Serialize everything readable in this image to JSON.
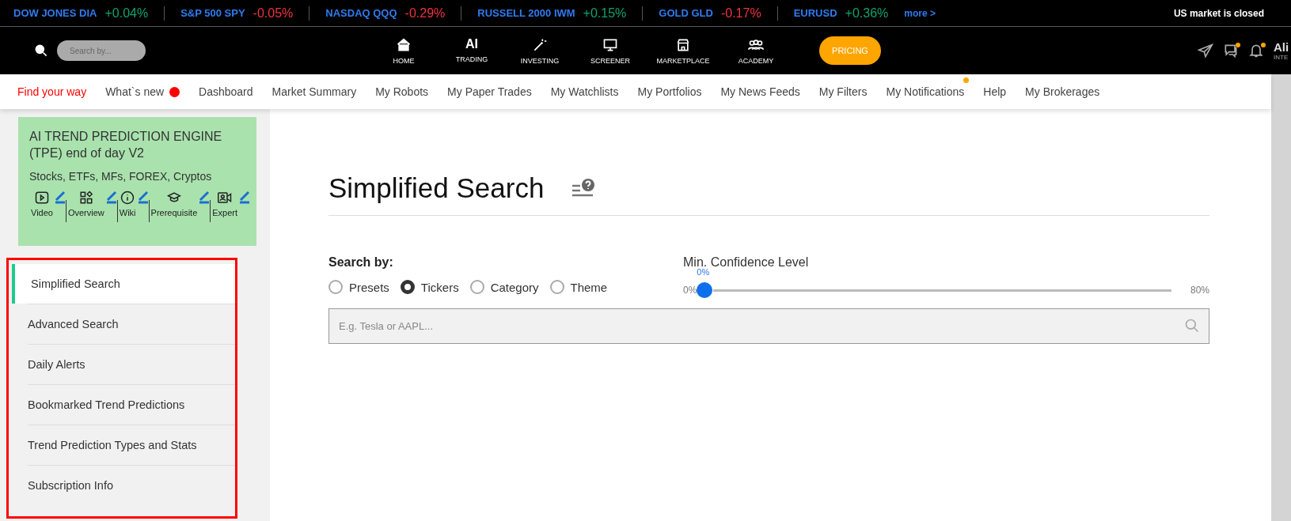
{
  "ticker": {
    "items": [
      {
        "name": "DOW JONES DIA",
        "change": "+0.04%",
        "color": "#10a36b"
      },
      {
        "name": "S&P 500 SPY",
        "change": "-0.05%",
        "color": "#f0323f"
      },
      {
        "name": "NASDAQ QQQ",
        "change": "-0.29%",
        "color": "#f0323f"
      },
      {
        "name": "RUSSELL 2000 IWM",
        "change": "+0.15%",
        "color": "#10a36b"
      },
      {
        "name": "GOLD GLD",
        "change": "-0.17%",
        "color": "#f0323f"
      },
      {
        "name": "EURUSD",
        "change": "+0.36%",
        "color": "#10a36b"
      }
    ],
    "more": "more >",
    "status": "US market is closed"
  },
  "header": {
    "search": {
      "placeholder": "Search by..."
    },
    "nav": [
      {
        "label": "HOME"
      },
      {
        "label": "TRADING",
        "mark": "AI"
      },
      {
        "label": "INVESTING"
      },
      {
        "label": "SCREENER"
      },
      {
        "label": "MARKETPLACE"
      },
      {
        "label": "ACADEMY"
      }
    ],
    "pricing": "PRICING",
    "alerts": [
      {
        "dot": false
      },
      {
        "dot": true
      },
      {
        "dot": true
      }
    ],
    "user": {
      "name": "Ali",
      "sub": "INTE"
    }
  },
  "subnav": [
    {
      "label": "Find your way",
      "selected": true
    },
    {
      "label": "What`s new",
      "selected": false,
      "color": "#ff0000"
    },
    {
      "label": "Dashboard",
      "selected": false
    },
    {
      "label": "Market Summary",
      "selected": false
    },
    {
      "label": "My Robots",
      "selected": false
    },
    {
      "label": "My Paper Trades",
      "selected": false
    },
    {
      "label": "My Watchlists",
      "selected": false
    },
    {
      "label": "My Portfolios",
      "selected": false
    },
    {
      "label": "My News Feeds",
      "selected": false
    },
    {
      "label": "My Filters",
      "selected": false
    },
    {
      "label": "My Notifications",
      "selected": false,
      "color": "#ffa500"
    },
    {
      "label": "Help",
      "selected": false
    },
    {
      "label": "My Brokerages",
      "selected": false
    }
  ],
  "card": {
    "title": "AI TREND PREDICTION ENGINE (TPE) end of day V2",
    "subtitle": "Stocks, ETFs, MFs, FOREX, Cryptos",
    "links": [
      {
        "label": "Video"
      },
      {
        "label": "Overview"
      },
      {
        "label": "Wiki"
      },
      {
        "label": "Prerequisite"
      },
      {
        "label": "Expert"
      }
    ]
  },
  "menu": [
    {
      "label": "Simplified Search",
      "selected": true
    },
    {
      "label": "Advanced Search",
      "selected": false
    },
    {
      "label": "Daily Alerts",
      "selected": false
    },
    {
      "label": "Bookmarked Trend Predictions",
      "selected": false
    },
    {
      "label": "Trend Prediction Types and Stats",
      "selected": false
    },
    {
      "label": "Subscription Info",
      "selected": false
    }
  ],
  "main": {
    "title": "Simplified Search",
    "search_by": "Search by:",
    "options": [
      {
        "label": "Presets",
        "selected": false
      },
      {
        "label": "Tickers",
        "selected": true
      },
      {
        "label": "Category",
        "selected": false
      },
      {
        "label": "Theme",
        "selected": false
      }
    ],
    "confidence": {
      "label": "Min. Confidence Level",
      "value": "0%",
      "min": "0%",
      "max": "80%",
      "level": 0
    },
    "input": {
      "placeholder": "E.g. Tesla or AAPL..."
    }
  }
}
